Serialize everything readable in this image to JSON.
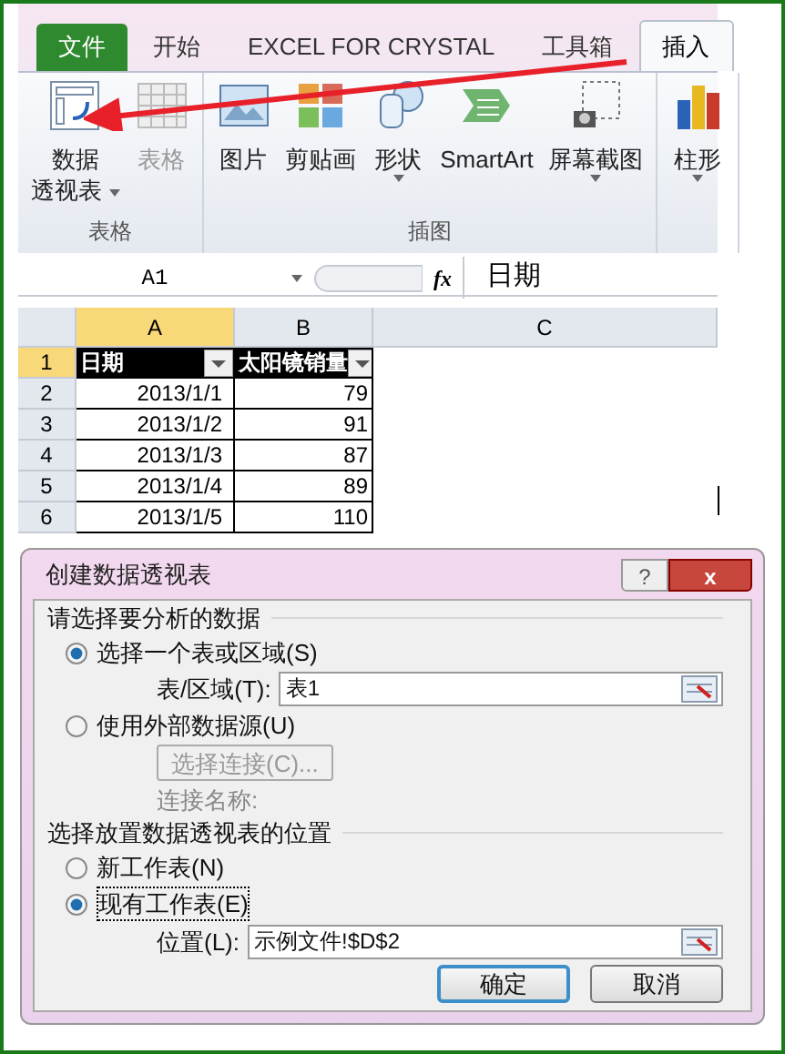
{
  "ribbon": {
    "tabs": [
      {
        "label": "文件",
        "kind": "file",
        "selected": false
      },
      {
        "label": "开始",
        "kind": "normal",
        "selected": false
      },
      {
        "label": "EXCEL FOR CRYSTAL",
        "kind": "normal",
        "selected": false
      },
      {
        "label": "工具箱",
        "kind": "normal",
        "selected": false
      },
      {
        "label": "插入",
        "kind": "normal",
        "selected": true
      }
    ],
    "groups": [
      {
        "label": "表格",
        "items": [
          {
            "lines": [
              "数据",
              "透视表"
            ],
            "dropdown": true,
            "disabled": false
          },
          {
            "lines": [
              "表格"
            ],
            "dropdown": false,
            "disabled": true
          }
        ]
      },
      {
        "label": "插图",
        "items": [
          {
            "lines": [
              "图片"
            ],
            "dropdown": false,
            "disabled": false
          },
          {
            "lines": [
              "剪贴画"
            ],
            "dropdown": false,
            "disabled": false
          },
          {
            "lines": [
              "形状"
            ],
            "dropdown": true,
            "disabled": false
          },
          {
            "lines": [
              "SmartArt"
            ],
            "dropdown": false,
            "disabled": false
          },
          {
            "lines": [
              "屏幕截图"
            ],
            "dropdown": true,
            "disabled": false
          }
        ]
      },
      {
        "items": [
          {
            "lines": [
              "柱形"
            ],
            "dropdown": true,
            "disabled": false
          }
        ]
      }
    ]
  },
  "formula_bar": {
    "name_box": "A1",
    "function_label": "fx",
    "formula": "日期"
  },
  "sheet": {
    "columns": [
      {
        "label": "A",
        "selected": true
      },
      {
        "label": "B",
        "selected": false
      },
      {
        "label": "C",
        "selected": false
      }
    ],
    "rows": [
      {
        "number": "1",
        "selected": true,
        "header": true,
        "cells": [
          "日期",
          "太阳镜销量"
        ]
      },
      {
        "number": "2",
        "selected": false,
        "header": false,
        "cells": [
          "2013/1/1",
          "79"
        ]
      },
      {
        "number": "3",
        "selected": false,
        "header": false,
        "cells": [
          "2013/1/2",
          "91"
        ]
      },
      {
        "number": "4",
        "selected": false,
        "header": false,
        "cells": [
          "2013/1/3",
          "87"
        ]
      },
      {
        "number": "5",
        "selected": false,
        "header": false,
        "cells": [
          "2013/1/4",
          "89"
        ]
      },
      {
        "number": "6",
        "selected": false,
        "header": false,
        "cells": [
          "2013/1/5",
          "110"
        ]
      }
    ]
  },
  "dialog": {
    "title": "创建数据透视表",
    "help": "?",
    "close": "x",
    "sections": [
      {
        "title": "请选择要分析的数据",
        "items": [
          {
            "kind": "radio",
            "label": "选择一个表或区域(S)",
            "selected": true
          },
          {
            "kind": "field",
            "label": "表/区域(T):",
            "value": "表1"
          },
          {
            "kind": "radio",
            "label": "使用外部数据源(U)",
            "selected": false
          },
          {
            "kind": "button",
            "label": "选择连接(C)...",
            "disabled": true
          },
          {
            "kind": "text",
            "label": "连接名称:",
            "disabled": true
          }
        ]
      },
      {
        "title": "选择放置数据透视表的位置",
        "items": [
          {
            "kind": "radio",
            "label": "新工作表(N)",
            "selected": false
          },
          {
            "kind": "radio",
            "label": "现有工作表(E)",
            "selected": true
          },
          {
            "kind": "field",
            "label": "位置(L):",
            "value": "示例文件!$D$2"
          }
        ]
      }
    ],
    "buttons": [
      {
        "label": "确定",
        "default": true
      },
      {
        "label": "取消",
        "default": false
      }
    ]
  }
}
